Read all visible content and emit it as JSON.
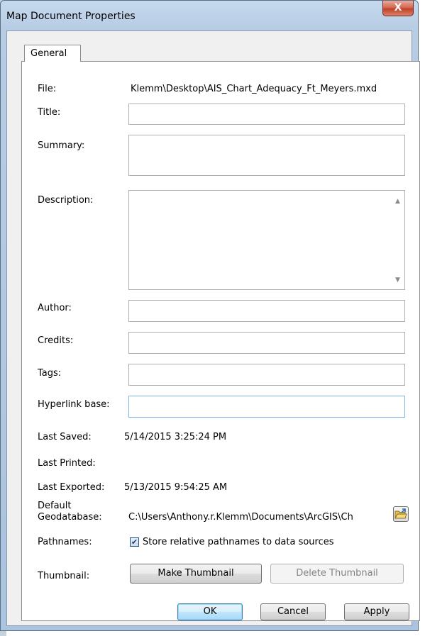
{
  "window": {
    "title": "Map Document Properties",
    "close_glyph": "X"
  },
  "tabs": [
    {
      "label": "General"
    }
  ],
  "fields": {
    "file": {
      "label": "File:",
      "value": "Klemm\\Desktop\\AIS_Chart_Adequacy_Ft_Meyers.mxd"
    },
    "title": {
      "label": "Title:",
      "value": ""
    },
    "summary": {
      "label": "Summary:",
      "value": ""
    },
    "description": {
      "label": "Description:",
      "value": ""
    },
    "author": {
      "label": "Author:",
      "value": ""
    },
    "credits": {
      "label": "Credits:",
      "value": ""
    },
    "tags": {
      "label": "Tags:",
      "value": ""
    },
    "hyperlink_base": {
      "label": "Hyperlink base:",
      "value": ""
    }
  },
  "info": {
    "last_saved": {
      "label": "Last Saved:",
      "value": "5/14/2015 3:25:24 PM"
    },
    "last_printed": {
      "label": "Last Printed:",
      "value": ""
    },
    "last_exported": {
      "label": "Last Exported:",
      "value": "5/13/2015 9:54:25 AM"
    },
    "default_geodatabase": {
      "label_line1": "Default",
      "label_line2": "Geodatabase:",
      "value": "C:\\Users\\Anthony.r.Klemm\\Documents\\ArcGIS\\Ch"
    }
  },
  "pathnames": {
    "label": "Pathnames:",
    "checkbox_label": "Store relative pathnames to data sources",
    "checked": true
  },
  "thumbnail": {
    "label": "Thumbnail:",
    "make_label": "Make Thumbnail",
    "delete_label": "Delete Thumbnail"
  },
  "footer": {
    "ok_label": "OK",
    "cancel_label": "Cancel",
    "apply_label": "Apply"
  },
  "icons": {
    "close": "close-icon",
    "folder": "open-folder-icon",
    "check": "checkmark-icon"
  },
  "colors": {
    "title_bar": "#bcd2e8",
    "close_button": "#c2412a",
    "focus_border": "#7eb4ea"
  }
}
